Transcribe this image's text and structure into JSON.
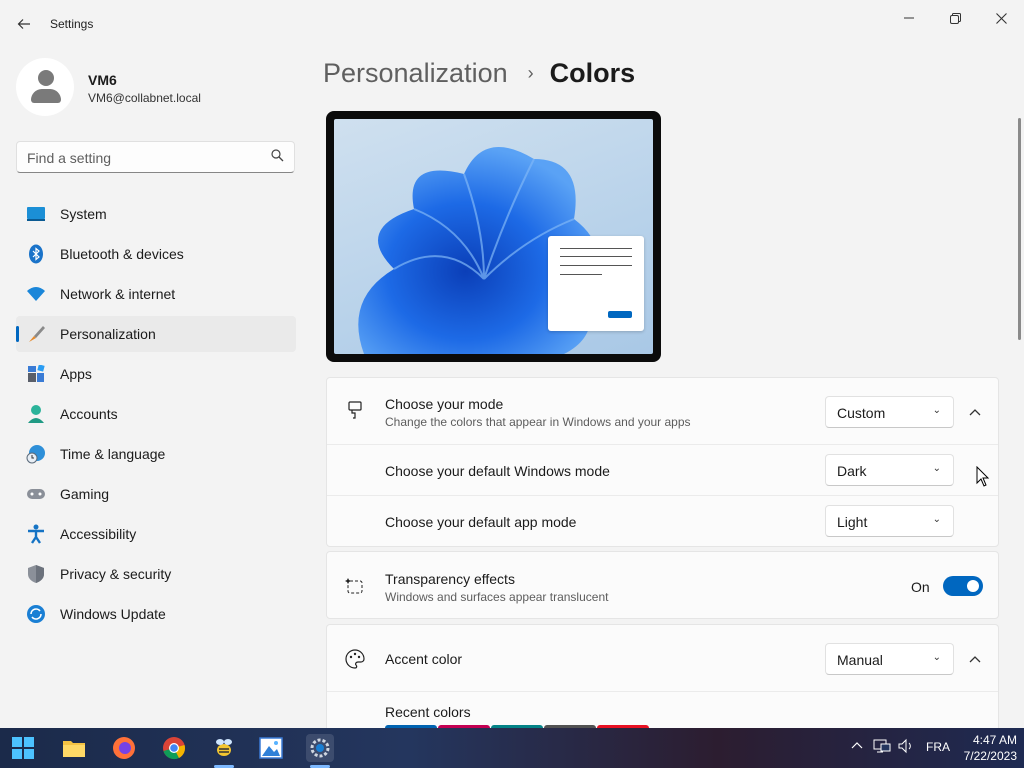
{
  "window": {
    "title": "Settings"
  },
  "profile": {
    "name": "VM6",
    "email": "VM6@collabnet.local"
  },
  "search": {
    "placeholder": "Find a setting"
  },
  "sidebar": {
    "items": [
      {
        "label": "System",
        "icon": "system-icon",
        "active": false
      },
      {
        "label": "Bluetooth & devices",
        "icon": "bluetooth-icon",
        "active": false
      },
      {
        "label": "Network & internet",
        "icon": "wifi-icon",
        "active": false
      },
      {
        "label": "Personalization",
        "icon": "paintbrush-icon",
        "active": true
      },
      {
        "label": "Apps",
        "icon": "apps-icon",
        "active": false
      },
      {
        "label": "Accounts",
        "icon": "person-icon",
        "active": false
      },
      {
        "label": "Time & language",
        "icon": "globe-clock-icon",
        "active": false
      },
      {
        "label": "Gaming",
        "icon": "gamepad-icon",
        "active": false
      },
      {
        "label": "Accessibility",
        "icon": "accessibility-icon",
        "active": false
      },
      {
        "label": "Privacy & security",
        "icon": "shield-icon",
        "active": false
      },
      {
        "label": "Windows Update",
        "icon": "update-icon",
        "active": false
      }
    ]
  },
  "breadcrumb": {
    "parent": "Personalization",
    "separator": "›",
    "current": "Colors"
  },
  "mode_card": {
    "title": "Choose your mode",
    "subtitle": "Change the colors that appear in Windows and your apps",
    "value": "Custom",
    "windows_mode_label": "Choose your default Windows mode",
    "windows_mode_value": "Dark",
    "app_mode_label": "Choose your default app mode",
    "app_mode_value": "Light"
  },
  "transparency": {
    "title": "Transparency effects",
    "subtitle": "Windows and surfaces appear translucent",
    "state_label": "On",
    "enabled": true
  },
  "accent": {
    "title": "Accent color",
    "value": "Manual",
    "recent_label": "Recent colors",
    "recent_colors": [
      "#0063b1",
      "#c30052",
      "#038387",
      "#525252",
      "#e81123"
    ]
  },
  "taskbar": {
    "apps": [
      "start-icon",
      "file-explorer-icon",
      "firefox-icon",
      "chrome-icon",
      "bee-app-icon",
      "photo-app-icon",
      "settings-icon"
    ],
    "language": "FRA",
    "time": "4:47 AM",
    "date": "7/22/2023"
  },
  "colors": {
    "accent": "#0067c0"
  }
}
